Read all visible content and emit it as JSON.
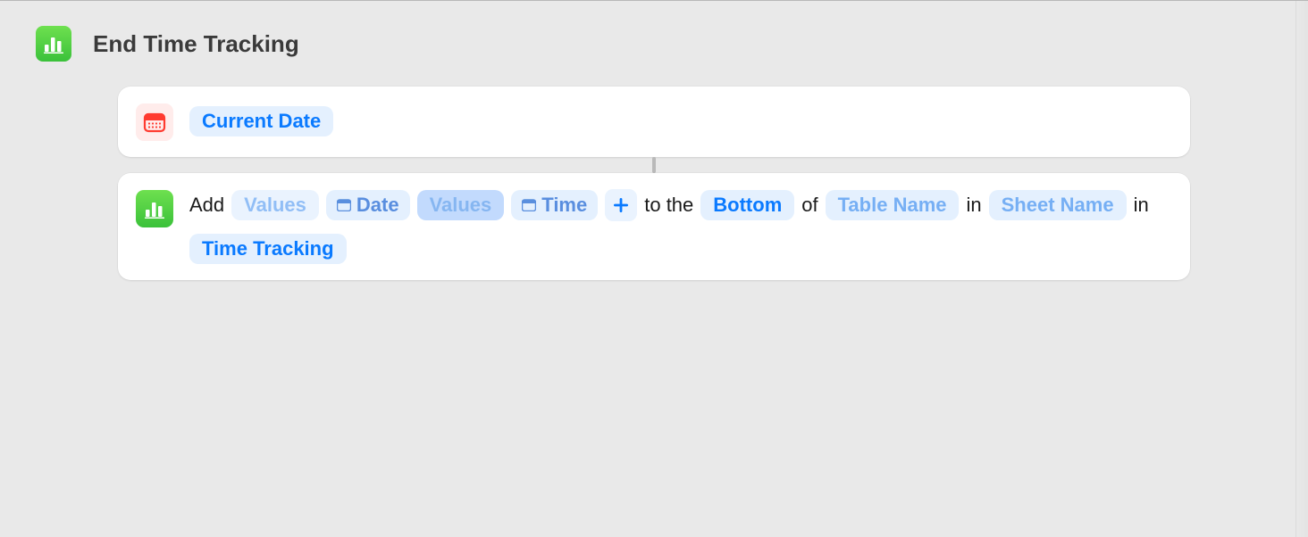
{
  "header": {
    "title": "End Time Tracking"
  },
  "actions": [
    {
      "icon": "calendar-icon",
      "tokens": [
        {
          "type": "value",
          "label": "Current Date"
        }
      ]
    },
    {
      "icon": "numbers-icon",
      "tokens": [
        {
          "type": "text",
          "label": "Add"
        },
        {
          "type": "placeholder",
          "label": "Values"
        },
        {
          "type": "variable",
          "label": "Date"
        },
        {
          "type": "placeholder-selected",
          "label": "Values"
        },
        {
          "type": "variable",
          "label": "Time"
        },
        {
          "type": "plus"
        },
        {
          "type": "text",
          "label": "to the"
        },
        {
          "type": "value",
          "label": "Bottom"
        },
        {
          "type": "text",
          "label": "of"
        },
        {
          "type": "placeholder-strong",
          "label": "Table Name"
        },
        {
          "type": "text",
          "label": "in"
        },
        {
          "type": "placeholder-strong",
          "label": "Sheet Name"
        },
        {
          "type": "text",
          "label": "in"
        },
        {
          "type": "value",
          "label": "Time Tracking"
        }
      ]
    }
  ]
}
